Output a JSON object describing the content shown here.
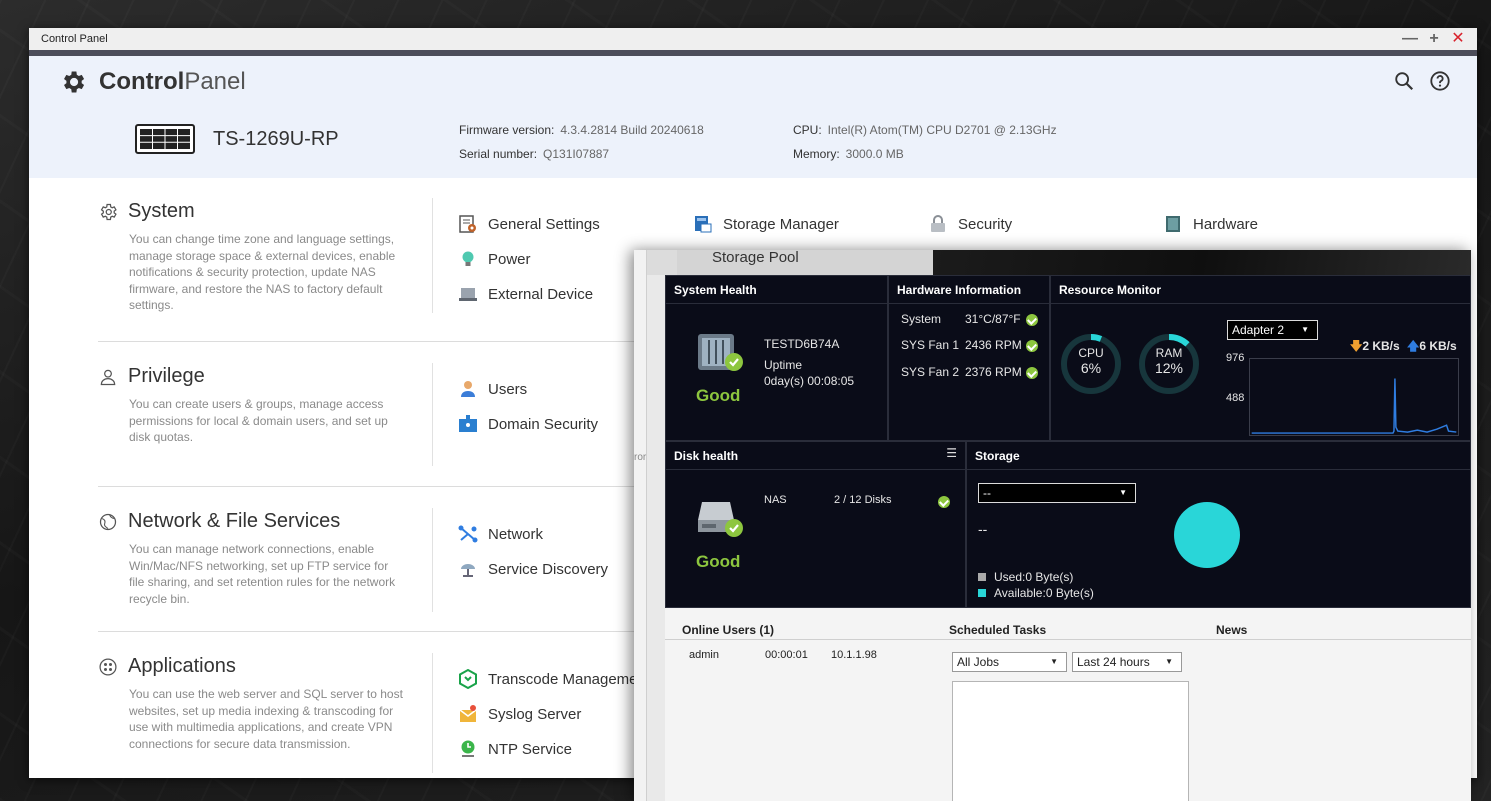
{
  "window": {
    "title": "Control Panel",
    "minimize": "—",
    "maximize": "+",
    "close": "✕"
  },
  "brand": {
    "bold": "Control",
    "light": "Panel"
  },
  "device": {
    "model": "TS-1269U-RP",
    "firmware_label": "Firmware version:",
    "firmware_value": "4.3.4.2814 Build 20240618",
    "serial_label": "Serial number:",
    "serial_value": "Q131I07887",
    "cpu_label": "CPU:",
    "cpu_value": "Intel(R) Atom(TM) CPU D2701 @ 2.13GHz",
    "memory_label": "Memory:",
    "memory_value": "3000.0 MB"
  },
  "sections": [
    {
      "title": "System",
      "icon": "gear-outline-icon",
      "desc": "You can change time zone and language settings, manage storage space & external devices, enable notifications & security protection, update NAS firmware, and restore the NAS to factory default settings.",
      "items": [
        "General Settings",
        "Power",
        "External Device",
        "Storage Manager",
        "Security",
        "Hardware"
      ]
    },
    {
      "title": "Privilege",
      "icon": "user-outline-icon",
      "desc": "You can create users & groups, manage access permissions for local & domain users, and set up disk quotas.",
      "items": [
        "Users",
        "Domain Security"
      ]
    },
    {
      "title": "Network & File Services",
      "icon": "globe-icon",
      "desc": "You can manage network connections, enable Win/Mac/NFS networking, set up FTP service for file sharing, and set retention rules for the network recycle bin.",
      "items": [
        "Network",
        "Service Discovery"
      ]
    },
    {
      "title": "Applications",
      "icon": "apps-icon",
      "desc": "You can use the web server and SQL server to host websites, set up media indexing & transcoding for use with multimedia applications, and create VPN connections for secure data transmission.",
      "items": [
        "Transcode Manageme",
        "Syslog Server",
        "NTP Service"
      ]
    }
  ],
  "storage_manager": {
    "left_strip_text": "ror",
    "tab": "Storage Pool",
    "system_health": {
      "title": "System Health",
      "name": "TESTD6B74A",
      "uptime_label": "Uptime",
      "uptime_value": "0day(s) 00:08:05",
      "status": "Good"
    },
    "hardware_info": {
      "title": "Hardware Information",
      "rows": [
        {
          "label": "System",
          "value": "31°C/87°F"
        },
        {
          "label": "SYS Fan 1",
          "value": "2436 RPM"
        },
        {
          "label": "SYS Fan 2",
          "value": "2376 RPM"
        }
      ]
    },
    "resource_monitor": {
      "title": "Resource Monitor",
      "cpu_label": "CPU",
      "cpu_value": "6%",
      "cpu_fraction": 0.06,
      "ram_label": "RAM",
      "ram_value": "12%",
      "ram_fraction": 0.12,
      "adapter": "Adapter 2",
      "download": "2 KB/s",
      "upload": "6 KB/s",
      "y_ticks": [
        "976",
        "488"
      ]
    },
    "disk_health": {
      "title": "Disk health",
      "device": "NAS",
      "disks": "2 / 12 Disks",
      "status": "Good"
    },
    "storage": {
      "title": "Storage",
      "select": "--",
      "value": "--",
      "used": "Used:0 Byte(s)",
      "available": "Available:0 Byte(s)",
      "colors": {
        "used": "#aaaaaa",
        "available": "#29d6d8"
      }
    },
    "online_users": {
      "title": "Online Users (1)",
      "rows": [
        {
          "user": "admin",
          "time": "00:00:01",
          "ip": "10.1.1.98"
        }
      ]
    },
    "scheduled_tasks": {
      "title": "Scheduled Tasks",
      "filter_jobs": "All Jobs",
      "filter_time": "Last 24 hours"
    },
    "news": {
      "title": "News"
    }
  },
  "colors": {
    "good": "#8dc63f",
    "accent": "#29d6d8",
    "net_line": "#2f7de1"
  }
}
